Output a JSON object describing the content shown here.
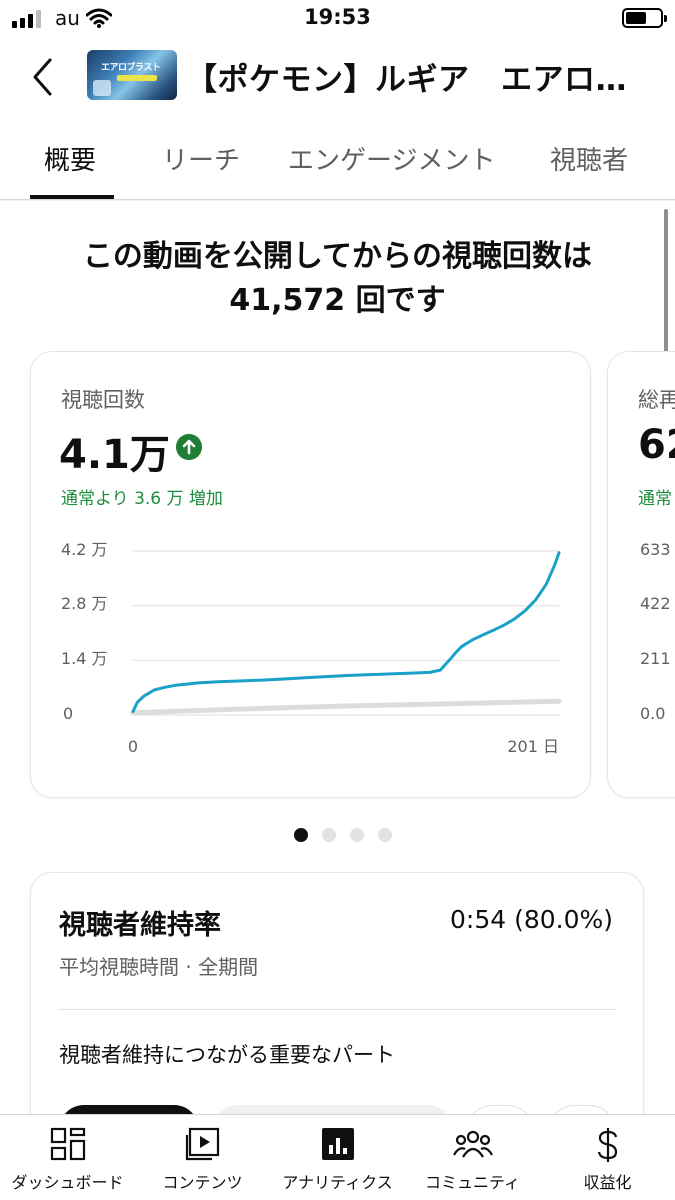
{
  "status_bar": {
    "carrier": "au",
    "time": "19:53"
  },
  "header": {
    "video_title": "【ポケモン】ルギア　エアロブラスト"
  },
  "thumbnail": {
    "text": "エアロブラスト"
  },
  "tabs": [
    {
      "label": "概要",
      "active": true
    },
    {
      "label": "リーチ",
      "active": false
    },
    {
      "label": "エンゲージメント",
      "active": false
    },
    {
      "label": "視聴者",
      "active": false
    }
  ],
  "headline": {
    "line1": "この動画を公開してからの視聴回数は",
    "line2": "41,572 回です"
  },
  "views_card": {
    "label": "視聴回数",
    "value": "4.1万",
    "delta": "通常より 3.6 万 増加",
    "trend": "up"
  },
  "next_card": {
    "label": "総再",
    "value": "62",
    "delta": "通常",
    "y_ticks": [
      "633",
      "422",
      "211",
      "0.0"
    ]
  },
  "chart_data": {
    "type": "line",
    "x_ticks": [
      "0",
      "201 日"
    ],
    "y_ticks": [
      "4.2 万",
      "2.8 万",
      "1.4 万",
      "0"
    ],
    "ylim": [
      0,
      42000
    ],
    "xlim": [
      0,
      201
    ],
    "grid": true,
    "series": [
      {
        "color": "#1aa1c9",
        "x": [
          0,
          2,
          5,
          10,
          15,
          20,
          25,
          30,
          40,
          50,
          60,
          70,
          80,
          90,
          100,
          110,
          120,
          130,
          140,
          145,
          150,
          152,
          155,
          160,
          165,
          170,
          175,
          180,
          185,
          190,
          195,
          199,
          201
        ],
        "y": [
          900,
          3200,
          4800,
          6400,
          7100,
          7600,
          7900,
          8200,
          8500,
          8700,
          8900,
          9200,
          9500,
          9800,
          10100,
          10300,
          10500,
          10700,
          10900,
          11500,
          14500,
          15800,
          17500,
          19200,
          20500,
          21700,
          23000,
          24600,
          26700,
          29500,
          33500,
          38500,
          41572
        ]
      },
      {
        "color": "#dcdcdc",
        "x": [
          0,
          50,
          100,
          150,
          201
        ],
        "y": [
          600,
          1500,
          2300,
          2900,
          3500
        ]
      }
    ]
  },
  "pagination": {
    "count": 4,
    "active": 0
  },
  "retention": {
    "title": "視聴者維持率",
    "value": "0:54 (80.0%)",
    "subtitle": "平均視聴時間 · 全期間",
    "key_moments": "視聴者維持につながる重要なパート"
  },
  "bottom_nav": [
    {
      "label": "ダッシュボード",
      "icon": "dashboard-icon"
    },
    {
      "label": "コンテンツ",
      "icon": "content-icon"
    },
    {
      "label": "アナリティクス",
      "icon": "analytics-icon",
      "active": true
    },
    {
      "label": "コミュニティ",
      "icon": "community-icon"
    },
    {
      "label": "収益化",
      "icon": "dollar-icon"
    }
  ]
}
